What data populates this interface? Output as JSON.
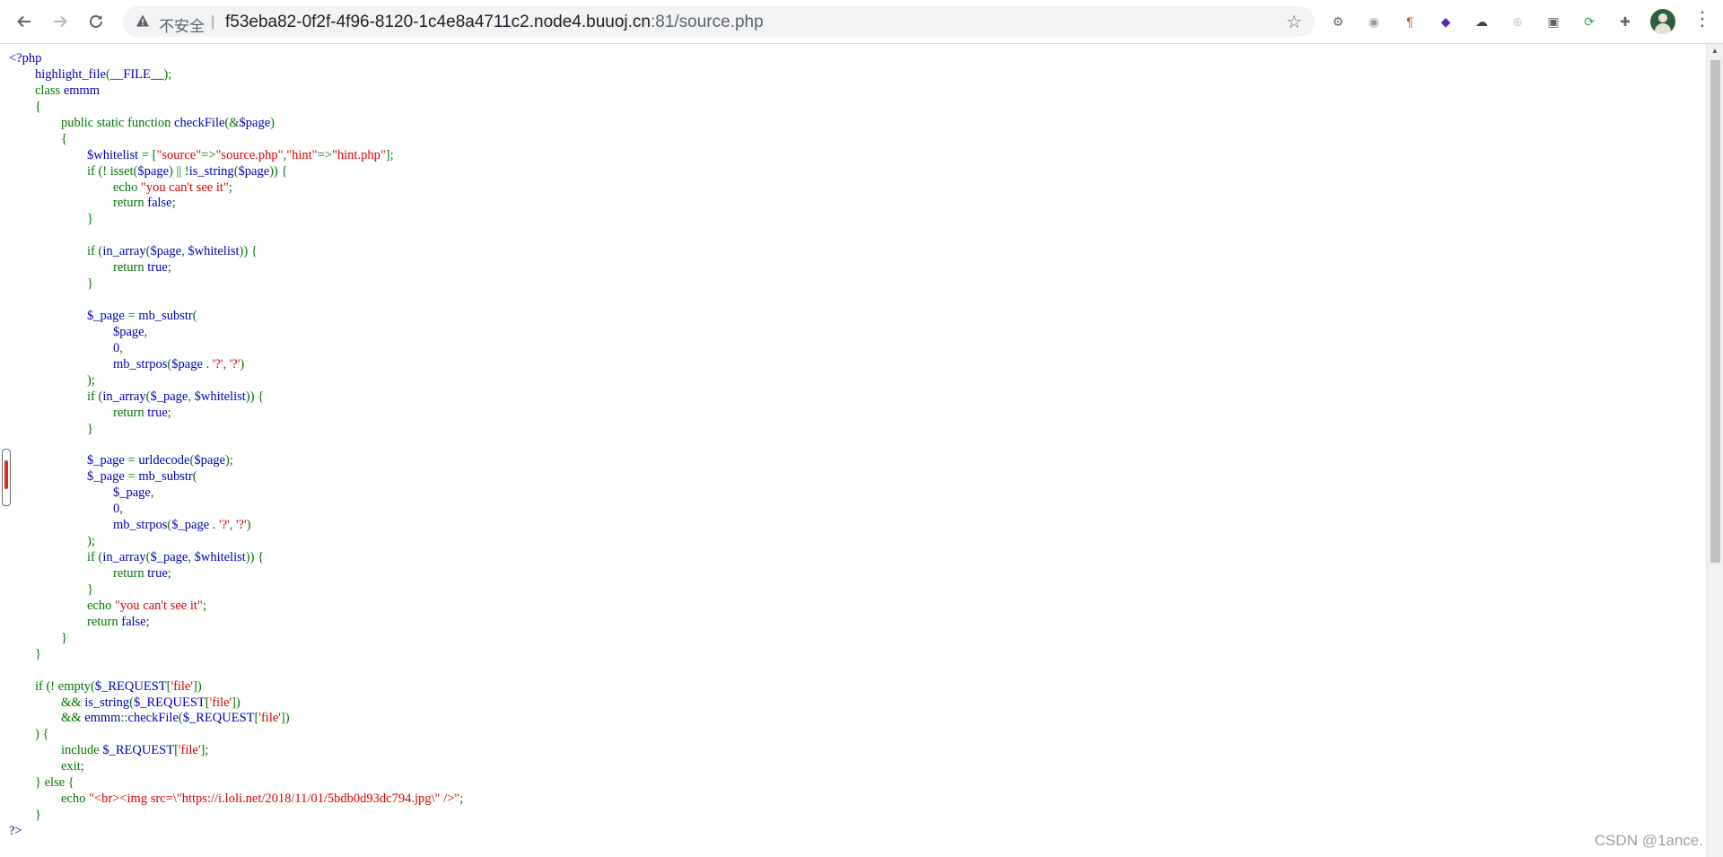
{
  "browser": {
    "security_label": "不安全",
    "url_separator": "|",
    "url_host": "f53eba82-0f2f-4f96-8120-1c4e8a4711c2.node4.buuoj.cn",
    "url_rest": ":81/source.php",
    "icons": {
      "back": "arrow-left-icon",
      "forward": "arrow-right-icon",
      "reload": "reload-icon",
      "warning": "warning-triangle-icon",
      "bookmark": "star-icon",
      "menu": "three-dots-vertical-icon"
    },
    "extensions": [
      {
        "name": "gear-extension-icon",
        "glyph": "⚙",
        "color": "#5f6368"
      },
      {
        "name": "circle-extension-icon",
        "glyph": "◉",
        "color": "#9e9e9e"
      },
      {
        "name": "pilcrow-extension-icon",
        "glyph": "¶",
        "color": "#c0572b"
      },
      {
        "name": "layers-extension-icon",
        "glyph": "◆",
        "color": "#5b2bb5"
      },
      {
        "name": "hat-extension-icon",
        "glyph": "☁",
        "color": "#444444"
      },
      {
        "name": "globe-extension-icon",
        "glyph": "⊕",
        "color": "#cccccc"
      },
      {
        "name": "panel-extension-icon",
        "glyph": "▣",
        "color": "#5f6368"
      },
      {
        "name": "refresh-extension-icon",
        "glyph": "⟳",
        "color": "#34a853"
      },
      {
        "name": "puzzle-extensions-icon",
        "glyph": "✚",
        "color": "#5f6368"
      }
    ]
  },
  "code_lines": [
    [
      {
        "t": "<?php",
        "c": "v"
      }
    ],
    [
      {
        "t": "        highlight_file",
        "c": "v"
      },
      {
        "t": "(",
        "c": "k"
      },
      {
        "t": "__FILE__",
        "c": "v"
      },
      {
        "t": ");",
        "c": "k"
      }
    ],
    [
      {
        "t": "        class ",
        "c": "k"
      },
      {
        "t": "emmm",
        "c": "v"
      }
    ],
    [
      {
        "t": "        {",
        "c": "k"
      }
    ],
    [
      {
        "t": "                public static function ",
        "c": "k"
      },
      {
        "t": "checkFile",
        "c": "v"
      },
      {
        "t": "(&",
        "c": "k"
      },
      {
        "t": "$page",
        "c": "v"
      },
      {
        "t": ")",
        "c": "k"
      }
    ],
    [
      {
        "t": "                {",
        "c": "k"
      }
    ],
    [
      {
        "t": "                        $whitelist ",
        "c": "v"
      },
      {
        "t": "= [",
        "c": "k"
      },
      {
        "t": "\"source\"",
        "c": "s"
      },
      {
        "t": "=>",
        "c": "k"
      },
      {
        "t": "\"source.php\"",
        "c": "s"
      },
      {
        "t": ",",
        "c": "k"
      },
      {
        "t": "\"hint\"",
        "c": "s"
      },
      {
        "t": "=>",
        "c": "k"
      },
      {
        "t": "\"hint.php\"",
        "c": "s"
      },
      {
        "t": "];",
        "c": "k"
      }
    ],
    [
      {
        "t": "                        if (! ",
        "c": "k"
      },
      {
        "t": "isset",
        "c": "k"
      },
      {
        "t": "(",
        "c": "k"
      },
      {
        "t": "$page",
        "c": "v"
      },
      {
        "t": ") || !",
        "c": "k"
      },
      {
        "t": "is_string",
        "c": "v"
      },
      {
        "t": "(",
        "c": "k"
      },
      {
        "t": "$page",
        "c": "v"
      },
      {
        "t": ")) {",
        "c": "k"
      }
    ],
    [
      {
        "t": "                                echo ",
        "c": "k"
      },
      {
        "t": "\"you can't see it\"",
        "c": "s"
      },
      {
        "t": ";",
        "c": "k"
      }
    ],
    [
      {
        "t": "                                return ",
        "c": "k"
      },
      {
        "t": "false",
        "c": "v"
      },
      {
        "t": ";",
        "c": "k"
      }
    ],
    [
      {
        "t": "                        }",
        "c": "k"
      }
    ],
    [],
    [
      {
        "t": "                        if (",
        "c": "k"
      },
      {
        "t": "in_array",
        "c": "v"
      },
      {
        "t": "(",
        "c": "k"
      },
      {
        "t": "$page",
        "c": "v"
      },
      {
        "t": ", ",
        "c": "k"
      },
      {
        "t": "$whitelist",
        "c": "v"
      },
      {
        "t": ")) {",
        "c": "k"
      }
    ],
    [
      {
        "t": "                                return ",
        "c": "k"
      },
      {
        "t": "true",
        "c": "v"
      },
      {
        "t": ";",
        "c": "k"
      }
    ],
    [
      {
        "t": "                        }",
        "c": "k"
      }
    ],
    [],
    [
      {
        "t": "                        $_page ",
        "c": "v"
      },
      {
        "t": "= ",
        "c": "k"
      },
      {
        "t": "mb_substr",
        "c": "v"
      },
      {
        "t": "(",
        "c": "k"
      }
    ],
    [
      {
        "t": "                                $page",
        "c": "v"
      },
      {
        "t": ",",
        "c": "k"
      }
    ],
    [
      {
        "t": "                                0",
        "c": "v"
      },
      {
        "t": ",",
        "c": "k"
      }
    ],
    [
      {
        "t": "                                mb_strpos",
        "c": "v"
      },
      {
        "t": "(",
        "c": "k"
      },
      {
        "t": "$page ",
        "c": "v"
      },
      {
        "t": ". ",
        "c": "k"
      },
      {
        "t": "'?'",
        "c": "s"
      },
      {
        "t": ", ",
        "c": "k"
      },
      {
        "t": "'?'",
        "c": "s"
      },
      {
        "t": ")",
        "c": "k"
      }
    ],
    [
      {
        "t": "                        );",
        "c": "k"
      }
    ],
    [
      {
        "t": "                        if (",
        "c": "k"
      },
      {
        "t": "in_array",
        "c": "v"
      },
      {
        "t": "(",
        "c": "k"
      },
      {
        "t": "$_page",
        "c": "v"
      },
      {
        "t": ", ",
        "c": "k"
      },
      {
        "t": "$whitelist",
        "c": "v"
      },
      {
        "t": ")) {",
        "c": "k"
      }
    ],
    [
      {
        "t": "                                return ",
        "c": "k"
      },
      {
        "t": "true",
        "c": "v"
      },
      {
        "t": ";",
        "c": "k"
      }
    ],
    [
      {
        "t": "                        }",
        "c": "k"
      }
    ],
    [],
    [
      {
        "t": "                        $_page ",
        "c": "v"
      },
      {
        "t": "= ",
        "c": "k"
      },
      {
        "t": "urldecode",
        "c": "v"
      },
      {
        "t": "(",
        "c": "k"
      },
      {
        "t": "$page",
        "c": "v"
      },
      {
        "t": ");",
        "c": "k"
      }
    ],
    [
      {
        "t": "                        $_page ",
        "c": "v"
      },
      {
        "t": "= ",
        "c": "k"
      },
      {
        "t": "mb_substr",
        "c": "v"
      },
      {
        "t": "(",
        "c": "k"
      }
    ],
    [
      {
        "t": "                                $_page",
        "c": "v"
      },
      {
        "t": ",",
        "c": "k"
      }
    ],
    [
      {
        "t": "                                0",
        "c": "v"
      },
      {
        "t": ",",
        "c": "k"
      }
    ],
    [
      {
        "t": "                                mb_strpos",
        "c": "v"
      },
      {
        "t": "(",
        "c": "k"
      },
      {
        "t": "$_page ",
        "c": "v"
      },
      {
        "t": ". ",
        "c": "k"
      },
      {
        "t": "'?'",
        "c": "s"
      },
      {
        "t": ", ",
        "c": "k"
      },
      {
        "t": "'?'",
        "c": "s"
      },
      {
        "t": ")",
        "c": "k"
      }
    ],
    [
      {
        "t": "                        );",
        "c": "k"
      }
    ],
    [
      {
        "t": "                        if (",
        "c": "k"
      },
      {
        "t": "in_array",
        "c": "v"
      },
      {
        "t": "(",
        "c": "k"
      },
      {
        "t": "$_page",
        "c": "v"
      },
      {
        "t": ", ",
        "c": "k"
      },
      {
        "t": "$whitelist",
        "c": "v"
      },
      {
        "t": ")) {",
        "c": "k"
      }
    ],
    [
      {
        "t": "                                return ",
        "c": "k"
      },
      {
        "t": "true",
        "c": "v"
      },
      {
        "t": ";",
        "c": "k"
      }
    ],
    [
      {
        "t": "                        }",
        "c": "k"
      }
    ],
    [
      {
        "t": "                        echo ",
        "c": "k"
      },
      {
        "t": "\"you can't see it\"",
        "c": "s"
      },
      {
        "t": ";",
        "c": "k"
      }
    ],
    [
      {
        "t": "                        return ",
        "c": "k"
      },
      {
        "t": "false",
        "c": "v"
      },
      {
        "t": ";",
        "c": "k"
      }
    ],
    [
      {
        "t": "                }",
        "c": "k"
      }
    ],
    [
      {
        "t": "        }",
        "c": "k"
      }
    ],
    [],
    [
      {
        "t": "        if (! ",
        "c": "k"
      },
      {
        "t": "empty",
        "c": "k"
      },
      {
        "t": "(",
        "c": "k"
      },
      {
        "t": "$_REQUEST",
        "c": "v"
      },
      {
        "t": "[",
        "c": "k"
      },
      {
        "t": "'file'",
        "c": "s"
      },
      {
        "t": "])",
        "c": "k"
      }
    ],
    [
      {
        "t": "                && ",
        "c": "k"
      },
      {
        "t": "is_string",
        "c": "v"
      },
      {
        "t": "(",
        "c": "k"
      },
      {
        "t": "$_REQUEST",
        "c": "v"
      },
      {
        "t": "[",
        "c": "k"
      },
      {
        "t": "'file'",
        "c": "s"
      },
      {
        "t": "])",
        "c": "k"
      }
    ],
    [
      {
        "t": "                && ",
        "c": "k"
      },
      {
        "t": "emmm",
        "c": "v"
      },
      {
        "t": "::",
        "c": "k"
      },
      {
        "t": "checkFile",
        "c": "v"
      },
      {
        "t": "(",
        "c": "k"
      },
      {
        "t": "$_REQUEST",
        "c": "v"
      },
      {
        "t": "[",
        "c": "k"
      },
      {
        "t": "'file'",
        "c": "s"
      },
      {
        "t": "])",
        "c": "k"
      }
    ],
    [
      {
        "t": "        ) {",
        "c": "k"
      }
    ],
    [
      {
        "t": "                include ",
        "c": "k"
      },
      {
        "t": "$_REQUEST",
        "c": "v"
      },
      {
        "t": "[",
        "c": "k"
      },
      {
        "t": "'file'",
        "c": "s"
      },
      {
        "t": "];",
        "c": "k"
      }
    ],
    [
      {
        "t": "                exit;",
        "c": "k"
      }
    ],
    [
      {
        "t": "        } else {",
        "c": "k"
      }
    ],
    [
      {
        "t": "                echo ",
        "c": "k"
      },
      {
        "t": "\"<br><img src=\\\"https://i.loli.net/2018/11/01/5bdb0d93dc794.jpg\\\" />\"",
        "c": "s"
      },
      {
        "t": ";",
        "c": "k"
      }
    ],
    [
      {
        "t": "        }",
        "c": "k"
      }
    ],
    [
      {
        "t": "?>",
        "c": "v"
      }
    ]
  ],
  "watermark": "CSDN @1ance."
}
